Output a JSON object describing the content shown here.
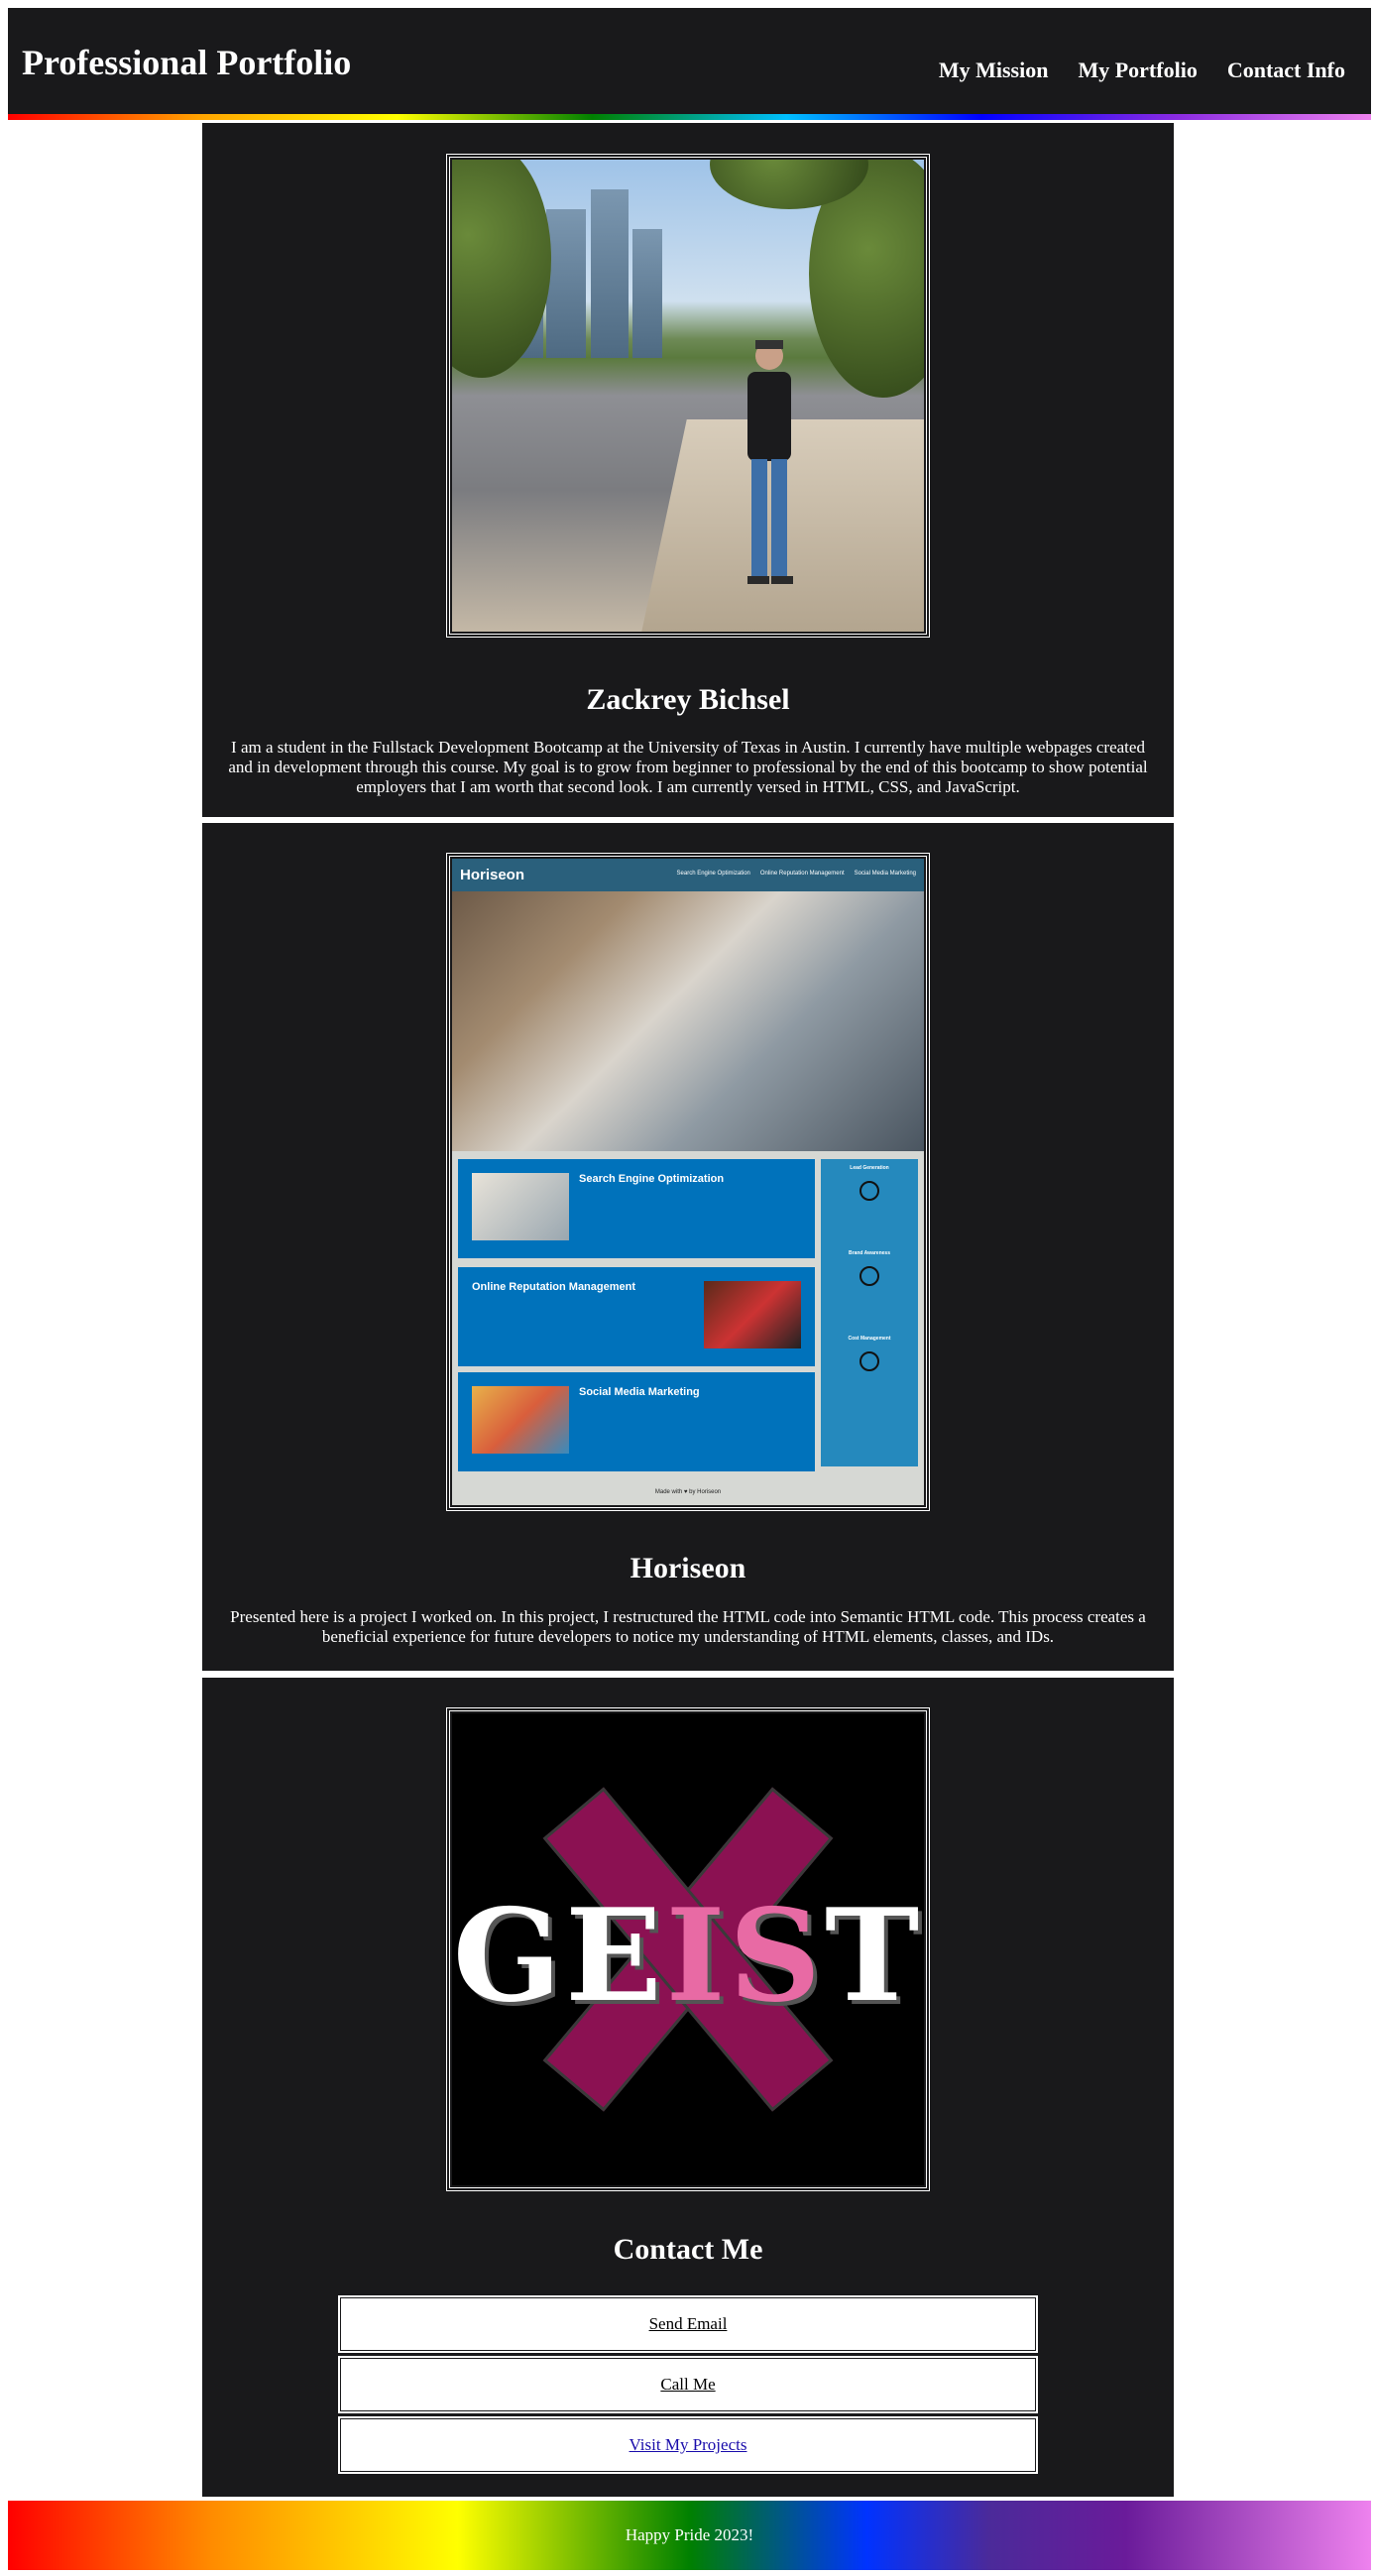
{
  "header": {
    "title": "Professional Portfolio",
    "nav": [
      "My Mission",
      "My Portfolio",
      "Contact Info"
    ]
  },
  "about": {
    "name": "Zackrey Bichsel",
    "text": "I am a student in the Fullstack Development Bootcamp at the University of Texas in Austin. I currently have multiple webpages created and in development through this course. My goal is to grow from beginner to professional by the end of this bootcamp to show potential employers that I am worth that second look. I am currently versed in HTML, CSS, and JavaScript."
  },
  "project": {
    "title": "Horiseon",
    "text": "Presented here is a project I worked on. In this project, I restructured the HTML code into Semantic HTML code. This process creates a beneficial experience for future developers to notice my understanding of HTML elements, classes, and IDs.",
    "mockup": {
      "logo": "Horiseon",
      "links": [
        "Search Engine Optimization",
        "Online Reputation Management",
        "Social Media Marketing"
      ],
      "cards": [
        "Search Engine Optimization",
        "Online Reputation Management",
        "Social Media Marketing"
      ],
      "aside": [
        "Lead Generation",
        "Brand Awareness",
        "Cost Management"
      ],
      "footer": "Made with ♥ by Horiseon"
    }
  },
  "geist": {
    "word_left": "GE",
    "word_mid": "IS",
    "word_right": "T"
  },
  "contact": {
    "title": "Contact Me",
    "items": [
      "Send Email",
      "Call Me",
      "Visit My Projects"
    ]
  },
  "footer": {
    "text": "Happy Pride 2023!"
  },
  "colors": {
    "panel": "#19191b",
    "accent_pink": "#8b1152",
    "horiseon_blue": "#0072bb"
  }
}
